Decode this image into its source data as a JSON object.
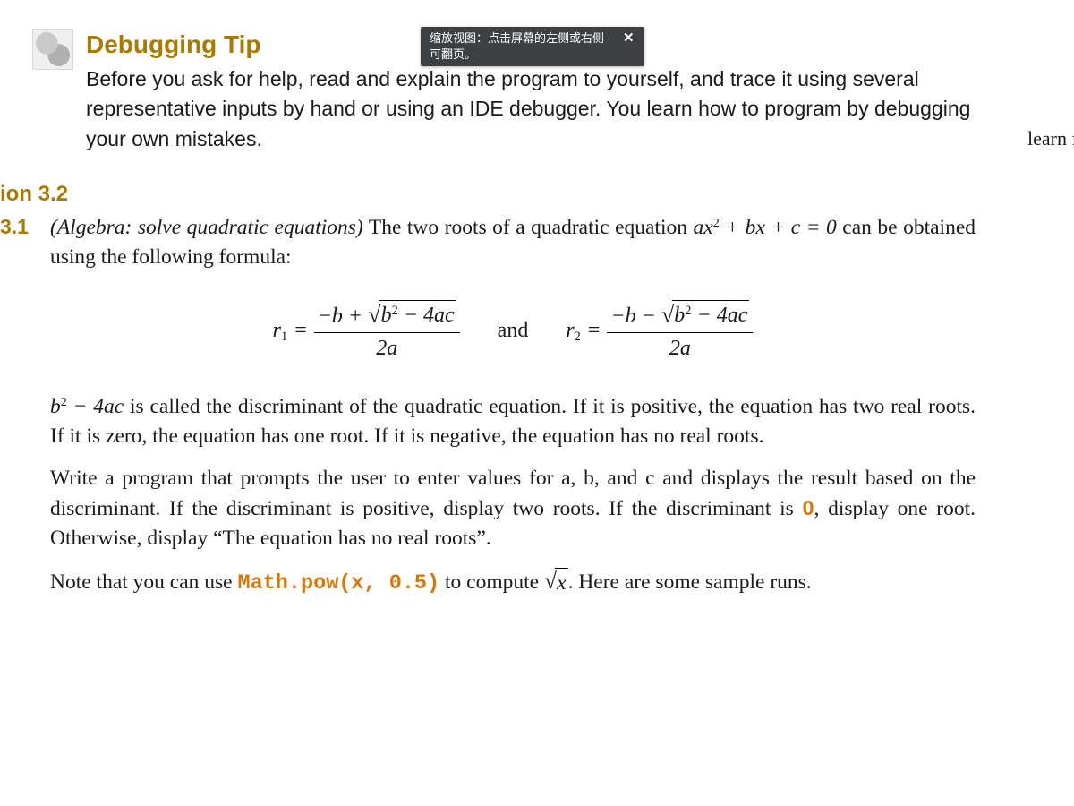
{
  "callout": {
    "icon_name": "note-bug-icon",
    "title": "Debugging Tip",
    "text": "Before you ask for help, read and explain the program to yourself, and trace it using several representative inputs by hand or using an IDE debugger. You learn how to program by debugging your own mistakes."
  },
  "hint": {
    "text": "缩放视图：点击屏幕的左侧或右侧\n可翻页。",
    "close_glyph": "✕"
  },
  "margin_note": "learn f",
  "section": {
    "number_fragment": "ion 3.2",
    "exercise_number": "3.1"
  },
  "exercise": {
    "intro_title": "(Algebra: solve quadratic equations)",
    "intro_rest_before_eq": " The two roots of a quadratic equation ",
    "intro_equation": "ax",
    "intro_eq_sup": "2",
    "intro_eq_tail": " + bx + c = 0",
    "intro_rest_after_eq": " can be obtained using the following formula:",
    "formula": {
      "r1": {
        "var": "r",
        "sub": "1"
      },
      "r2": {
        "var": "r",
        "sub": "2"
      },
      "num_plus_before": "−b + ",
      "num_minus_before": "−b − ",
      "under_sqrt_b": "b",
      "under_sqrt_sup": "2",
      "under_sqrt_tail": " − 4ac",
      "den": "2a",
      "and": "and"
    },
    "para_disc_lead_b": "b",
    "para_disc_lead_sup": "2",
    "para_disc_lead_tail": " − 4ac",
    "para_disc_rest": " is called the discriminant of the quadratic equation. If it is positive, the equation has two real roots. If it is zero, the equation has one root. If it is negative, the equation has no real roots.",
    "para_prompt_before_zero": "Write a program that prompts the user to enter values for a, b, and c and displays the result based on the discriminant. If the discriminant is positive, display two roots. If the discriminant is ",
    "zero": "0",
    "para_prompt_after_zero": ", display one root. Otherwise, display “The equation has no real roots”.",
    "para_note_before_code": "Note that you can use ",
    "code": "Math.pow(x, 0.5)",
    "para_note_mid": " to compute ",
    "note_sqrt_var": "x",
    "para_note_after": ". Here are some sample runs."
  }
}
